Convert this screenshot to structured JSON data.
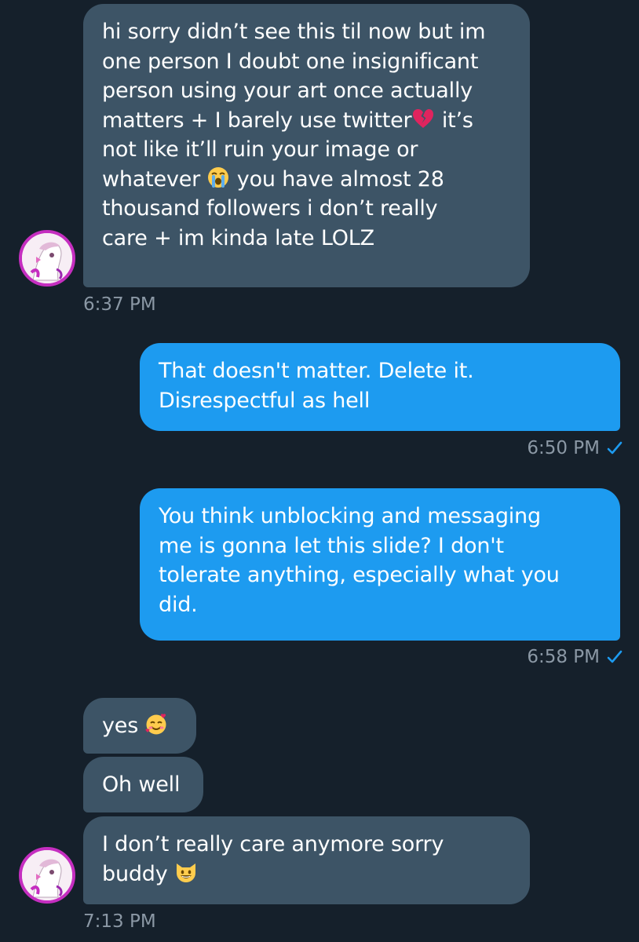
{
  "messages": [
    {
      "side": "incoming",
      "text_a": "hi sorry didn’t see this til now but im\none person I doubt one insignificant\nperson using your art once actually\nmatters + I barely use twitter",
      "text_b": " it’s\nnot like it’ll ruin your image or\nwhatever ",
      "text_c": " you have almost 28\nthousand followers i don’t really\ncare + im kinda late LOLZ",
      "emoji_1": "broken-heart-icon",
      "emoji_2": "loudly-crying-face-icon",
      "time": "6:37 PM"
    },
    {
      "side": "outgoing",
      "text": "That doesn't matter. Delete it.\nDisrespectful as hell",
      "time": "6:50 PM",
      "status_icon": "check-icon"
    },
    {
      "side": "outgoing",
      "text": "You think unblocking and messaging\nme is gonna let this slide? I don't\ntolerate anything, especially what you\ndid.",
      "time": "6:58 PM",
      "status_icon": "check-icon"
    },
    {
      "side": "incoming",
      "text": "yes ",
      "emoji": "smiling-face-with-hearts-icon"
    },
    {
      "side": "incoming",
      "text": "Oh well"
    },
    {
      "side": "incoming",
      "text_a": "I don’t really care anymore sorry\nbuddy ",
      "emoji": "grinning-cat-icon",
      "time": "7:13 PM"
    }
  ],
  "colors": {
    "background": "#15202b",
    "incoming_bubble": "#3d5466",
    "outgoing_bubble": "#1d9bf0",
    "timestamp": "#8b98a5",
    "check": "#1d9bf0",
    "avatar_ring": "#c52ec0"
  }
}
